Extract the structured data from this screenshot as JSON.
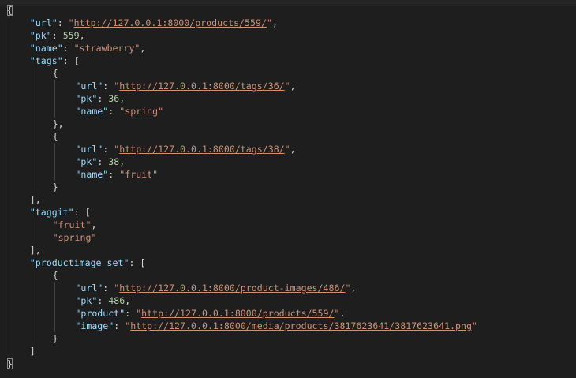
{
  "lines": [
    {
      "indent": 0,
      "hl": true,
      "tokens": [
        {
          "t": "punc",
          "v": "{"
        }
      ]
    },
    {
      "indent": 1,
      "tokens": [
        {
          "t": "key",
          "v": "\"url\""
        },
        {
          "t": "punc",
          "v": ": "
        },
        {
          "t": "str",
          "v": "\""
        },
        {
          "t": "link",
          "v": "http://127.0.0.1:8000/products/559/"
        },
        {
          "t": "str",
          "v": "\""
        },
        {
          "t": "punc",
          "v": ","
        }
      ]
    },
    {
      "indent": 1,
      "tokens": [
        {
          "t": "key",
          "v": "\"pk\""
        },
        {
          "t": "punc",
          "v": ": "
        },
        {
          "t": "num",
          "v": "559"
        },
        {
          "t": "punc",
          "v": ","
        }
      ]
    },
    {
      "indent": 1,
      "tokens": [
        {
          "t": "key",
          "v": "\"name\""
        },
        {
          "t": "punc",
          "v": ": "
        },
        {
          "t": "str",
          "v": "\"strawberry\""
        },
        {
          "t": "punc",
          "v": ","
        }
      ]
    },
    {
      "indent": 1,
      "tokens": [
        {
          "t": "key",
          "v": "\"tags\""
        },
        {
          "t": "punc",
          "v": ": ["
        }
      ]
    },
    {
      "indent": 2,
      "tokens": [
        {
          "t": "punc",
          "v": "{"
        }
      ]
    },
    {
      "indent": 3,
      "tokens": [
        {
          "t": "key",
          "v": "\"url\""
        },
        {
          "t": "punc",
          "v": ": "
        },
        {
          "t": "str",
          "v": "\""
        },
        {
          "t": "link",
          "v": "http://127.0.0.1:8000/tags/36/"
        },
        {
          "t": "str",
          "v": "\""
        },
        {
          "t": "punc",
          "v": ","
        }
      ]
    },
    {
      "indent": 3,
      "tokens": [
        {
          "t": "key",
          "v": "\"pk\""
        },
        {
          "t": "punc",
          "v": ": "
        },
        {
          "t": "num",
          "v": "36"
        },
        {
          "t": "punc",
          "v": ","
        }
      ]
    },
    {
      "indent": 3,
      "tokens": [
        {
          "t": "key",
          "v": "\"name\""
        },
        {
          "t": "punc",
          "v": ": "
        },
        {
          "t": "str",
          "v": "\"spring\""
        }
      ]
    },
    {
      "indent": 2,
      "tokens": [
        {
          "t": "punc",
          "v": "},"
        }
      ]
    },
    {
      "indent": 2,
      "tokens": [
        {
          "t": "punc",
          "v": "{"
        }
      ]
    },
    {
      "indent": 3,
      "tokens": [
        {
          "t": "key",
          "v": "\"url\""
        },
        {
          "t": "punc",
          "v": ": "
        },
        {
          "t": "str",
          "v": "\""
        },
        {
          "t": "link",
          "v": "http://127.0.0.1:8000/tags/38/"
        },
        {
          "t": "str",
          "v": "\""
        },
        {
          "t": "punc",
          "v": ","
        }
      ]
    },
    {
      "indent": 3,
      "tokens": [
        {
          "t": "key",
          "v": "\"pk\""
        },
        {
          "t": "punc",
          "v": ": "
        },
        {
          "t": "num",
          "v": "38"
        },
        {
          "t": "punc",
          "v": ","
        }
      ]
    },
    {
      "indent": 3,
      "tokens": [
        {
          "t": "key",
          "v": "\"name\""
        },
        {
          "t": "punc",
          "v": ": "
        },
        {
          "t": "str",
          "v": "\"fruit\""
        }
      ]
    },
    {
      "indent": 2,
      "tokens": [
        {
          "t": "punc",
          "v": "}"
        }
      ]
    },
    {
      "indent": 1,
      "tokens": [
        {
          "t": "punc",
          "v": "],"
        }
      ]
    },
    {
      "indent": 1,
      "tokens": [
        {
          "t": "key",
          "v": "\"taggit\""
        },
        {
          "t": "punc",
          "v": ": ["
        }
      ]
    },
    {
      "indent": 2,
      "tokens": [
        {
          "t": "str",
          "v": "\"fruit\""
        },
        {
          "t": "punc",
          "v": ","
        }
      ]
    },
    {
      "indent": 2,
      "tokens": [
        {
          "t": "str",
          "v": "\"spring\""
        }
      ]
    },
    {
      "indent": 1,
      "tokens": [
        {
          "t": "punc",
          "v": "],"
        }
      ]
    },
    {
      "indent": 1,
      "tokens": [
        {
          "t": "key",
          "v": "\"productimage_set\""
        },
        {
          "t": "punc",
          "v": ": ["
        }
      ]
    },
    {
      "indent": 2,
      "tokens": [
        {
          "t": "punc",
          "v": "{"
        }
      ]
    },
    {
      "indent": 3,
      "tokens": [
        {
          "t": "key",
          "v": "\"url\""
        },
        {
          "t": "punc",
          "v": ": "
        },
        {
          "t": "str",
          "v": "\""
        },
        {
          "t": "link",
          "v": "http://127.0.0.1:8000/product-images/486/"
        },
        {
          "t": "str",
          "v": "\""
        },
        {
          "t": "punc",
          "v": ","
        }
      ]
    },
    {
      "indent": 3,
      "tokens": [
        {
          "t": "key",
          "v": "\"pk\""
        },
        {
          "t": "punc",
          "v": ": "
        },
        {
          "t": "num",
          "v": "486"
        },
        {
          "t": "punc",
          "v": ","
        }
      ]
    },
    {
      "indent": 3,
      "tokens": [
        {
          "t": "key",
          "v": "\"product\""
        },
        {
          "t": "punc",
          "v": ": "
        },
        {
          "t": "str",
          "v": "\""
        },
        {
          "t": "link",
          "v": "http://127.0.0.1:8000/products/559/"
        },
        {
          "t": "str",
          "v": "\""
        },
        {
          "t": "punc",
          "v": ","
        }
      ]
    },
    {
      "indent": 3,
      "tokens": [
        {
          "t": "key",
          "v": "\"image\""
        },
        {
          "t": "punc",
          "v": ": "
        },
        {
          "t": "str",
          "v": "\""
        },
        {
          "t": "link",
          "v": "http://127.0.0.1:8000/media/products/3817623641/3817623641.png"
        },
        {
          "t": "str",
          "v": "\""
        }
      ]
    },
    {
      "indent": 2,
      "tokens": [
        {
          "t": "punc",
          "v": "}"
        }
      ]
    },
    {
      "indent": 1,
      "tokens": [
        {
          "t": "punc",
          "v": "]"
        }
      ]
    },
    {
      "indent": 0,
      "hl": true,
      "tokens": [
        {
          "t": "punc",
          "v": "}"
        }
      ]
    }
  ]
}
